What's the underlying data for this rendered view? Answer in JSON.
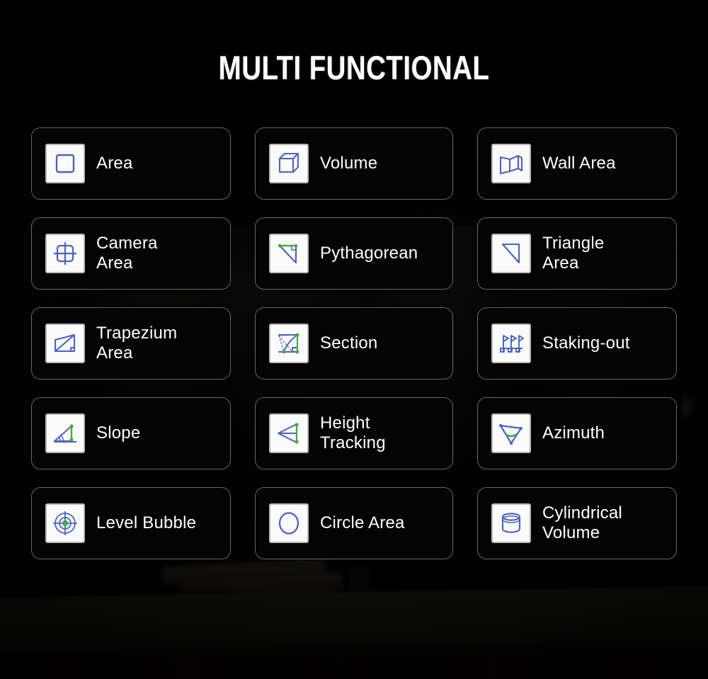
{
  "header": {
    "title": "MULTI FUNCTIONAL"
  },
  "theme": {
    "background": "#050505",
    "card_background": "#040404",
    "card_border": "#bababa",
    "icon_tile_background": "#fbfbfb",
    "icon_tile_border": "#b9b9b9",
    "icon_accent_blue": "#4a63c0",
    "icon_accent_green": "#3fae3f",
    "label_color": "#ffffff",
    "title_color": "#ffffff"
  },
  "grid": {
    "columns": 3,
    "rows": 5,
    "items": [
      {
        "label": "Area",
        "icon": "square-outline-icon",
        "multiline": false
      },
      {
        "label": "Volume",
        "icon": "cube-3d-icon",
        "multiline": false
      },
      {
        "label": "Wall Area",
        "icon": "wall-panels-icon",
        "multiline": false
      },
      {
        "label": "Camera\nArea",
        "icon": "camera-frame-icon",
        "multiline": true
      },
      {
        "label": "Pythagorean",
        "icon": "pythagorean-triangle-icon",
        "multiline": false
      },
      {
        "label": "Triangle\nArea",
        "icon": "right-triangle-icon",
        "multiline": true
      },
      {
        "label": "Trapezium\nArea",
        "icon": "trapezium-icon",
        "multiline": true
      },
      {
        "label": "Section",
        "icon": "section-profile-icon",
        "multiline": false
      },
      {
        "label": "Staking-out",
        "icon": "stakes-flags-icon",
        "multiline": false
      },
      {
        "label": "Slope",
        "icon": "slope-angle-icon",
        "multiline": false
      },
      {
        "label": "Height\nTracking",
        "icon": "height-tracking-icon",
        "multiline": true
      },
      {
        "label": "Azimuth",
        "icon": "azimuth-arc-icon",
        "multiline": false
      },
      {
        "label": "Level Bubble",
        "icon": "level-bubble-target-icon",
        "multiline": false
      },
      {
        "label": "Circle Area",
        "icon": "circle-outline-icon",
        "multiline": false
      },
      {
        "label": "Cylindrical\nVolume",
        "icon": "cylinder-3d-icon",
        "multiline": true
      }
    ]
  }
}
